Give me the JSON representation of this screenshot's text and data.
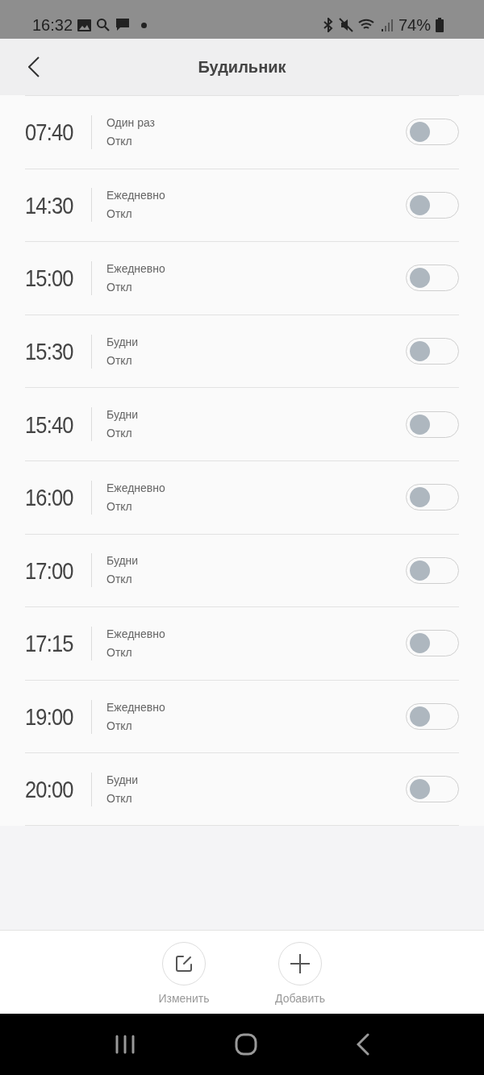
{
  "status_bar": {
    "time": "16:32",
    "battery": "74%"
  },
  "header": {
    "title": "Будильник"
  },
  "alarms": [
    {
      "time": "07:40",
      "repeat": "Один раз",
      "status": "Откл",
      "on": false
    },
    {
      "time": "14:30",
      "repeat": "Ежедневно",
      "status": "Откл",
      "on": false
    },
    {
      "time": "15:00",
      "repeat": "Ежедневно",
      "status": "Откл",
      "on": false
    },
    {
      "time": "15:30",
      "repeat": "Будни",
      "status": "Откл",
      "on": false
    },
    {
      "time": "15:40",
      "repeat": "Будни",
      "status": "Откл",
      "on": false
    },
    {
      "time": "16:00",
      "repeat": "Ежедневно",
      "status": "Откл",
      "on": false
    },
    {
      "time": "17:00",
      "repeat": "Будни",
      "status": "Откл",
      "on": false
    },
    {
      "time": "17:15",
      "repeat": "Ежедневно",
      "status": "Откл",
      "on": false
    },
    {
      "time": "19:00",
      "repeat": "Ежедневно",
      "status": "Откл",
      "on": false
    },
    {
      "time": "20:00",
      "repeat": "Будни",
      "status": "Откл",
      "on": false
    }
  ],
  "toolbar": [
    {
      "kind": "edit",
      "label": "Изменить"
    },
    {
      "kind": "add",
      "label": "Добавить"
    }
  ]
}
